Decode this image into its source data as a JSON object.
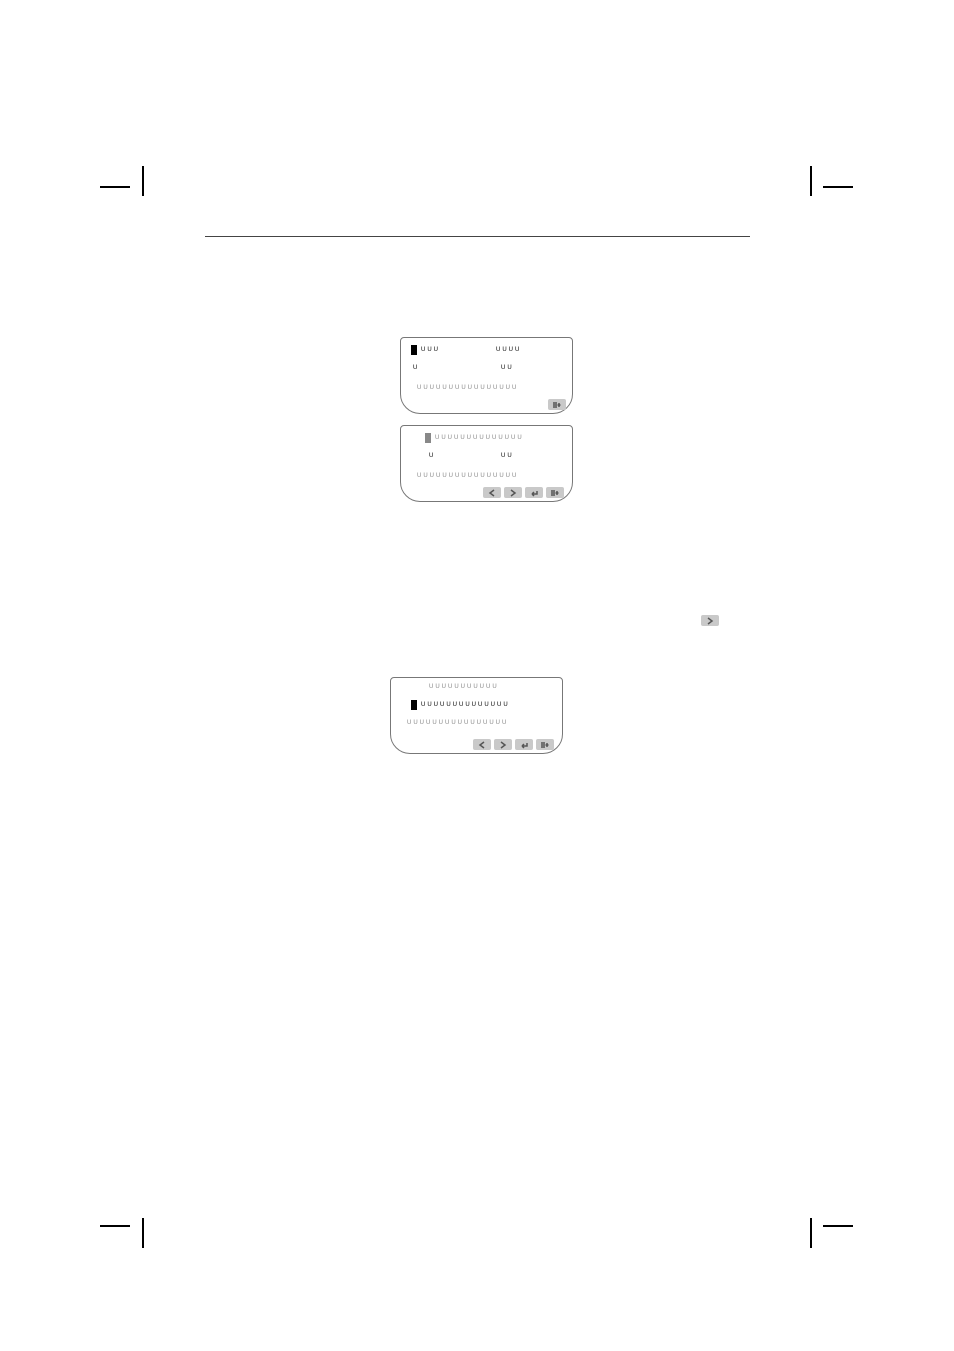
{
  "marks": {
    "tl": "crop-mark",
    "tr": "crop-mark",
    "bl": "crop-mark",
    "br": "crop-mark"
  },
  "divider": "horizontal-rule",
  "lcd_panel_1": {
    "row1_left": "UUU",
    "row1_right": "UUUU",
    "row2_left": "U",
    "row2_right": "UU",
    "row3": "UUUUUUUUUUUUUUUU",
    "actions": [
      "list-add"
    ]
  },
  "lcd_panel_2": {
    "row1": "UUUUUUUUUUUUUU",
    "row2_left": "U",
    "row2_right": "UU",
    "row3": "UUUUUUUUUUUUUUUU",
    "actions": [
      "prev",
      "next",
      "enter",
      "list-add"
    ]
  },
  "inline_chip": ">",
  "lcd_panel_3": {
    "row1": "UUUUUUUUUUU",
    "row2": "UUUUUUUUUUUUUU",
    "row3": "UUUUUUUUUUUUUUUU",
    "actions": [
      "prev",
      "next",
      "enter",
      "list-add"
    ]
  }
}
